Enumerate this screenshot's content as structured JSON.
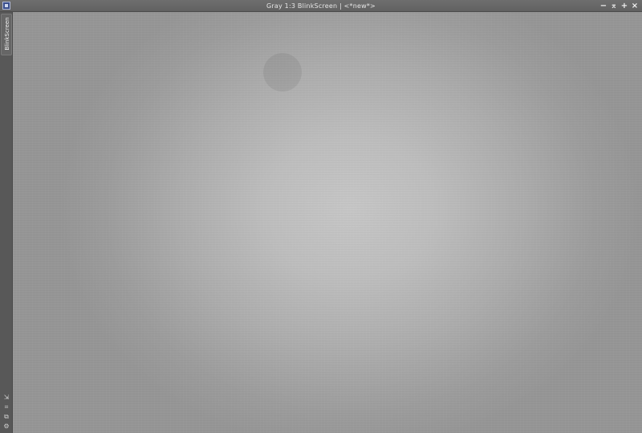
{
  "window": {
    "title": "Gray 1:3 BlinkScreen | <*new*>",
    "controls": {
      "minimize": "−",
      "shade": "⌅",
      "maximize": "+",
      "close": "×"
    }
  },
  "sidebar": {
    "tab_label": "BlinkScreen",
    "tools": [
      "zoom-icon",
      "fit-icon",
      "copy-icon",
      "settings-icon"
    ]
  },
  "canvas": {
    "color_mode": "Gray",
    "zoom_ratio": "1:3"
  },
  "colors": {
    "titlebar": "#666666",
    "sidebar": "#585858",
    "canvas_center": "#c6c6c6",
    "canvas_edge": "#969696"
  }
}
